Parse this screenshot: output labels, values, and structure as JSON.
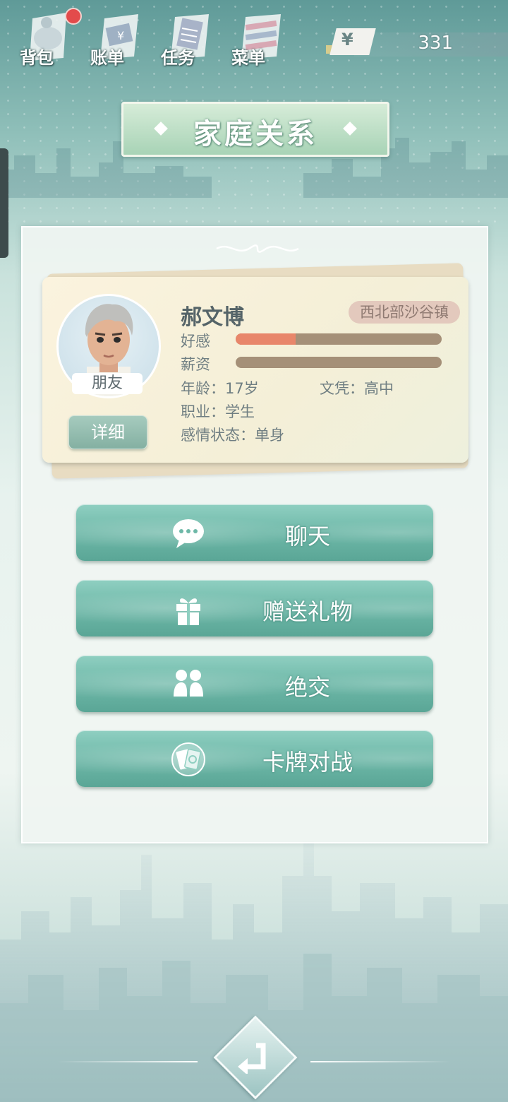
{
  "topbar": {
    "items": [
      {
        "label": "背包",
        "icon": "backpack-icon"
      },
      {
        "label": "账单",
        "icon": "bill-icon"
      },
      {
        "label": "任务",
        "icon": "task-icon"
      },
      {
        "label": "菜单",
        "icon": "menu-icon"
      }
    ],
    "currency_symbol": "¥",
    "money": "331"
  },
  "title": "家庭关系",
  "card": {
    "name": "郝文博",
    "region": "西北部沙谷镇",
    "relationship": "朋友",
    "detail_label": "详细",
    "favor_label": "好感",
    "favor_value": 0.29,
    "salary_label": "薪资",
    "salary_value": 0,
    "age": "年龄：17岁",
    "education": "文凭：高中",
    "job": "职业：学生",
    "marital": "感情状态：单身"
  },
  "actions": [
    {
      "label": "聊天",
      "icon": "chat-icon"
    },
    {
      "label": "赠送礼物",
      "icon": "gift-icon"
    },
    {
      "label": "绝交",
      "icon": "break-friendship-icon"
    },
    {
      "label": "卡牌对战",
      "icon": "card-battle-icon"
    }
  ],
  "colors": {
    "accent": "#6eb8a8",
    "favor_bar": "#e8866a",
    "bar_track": "#a59078"
  }
}
